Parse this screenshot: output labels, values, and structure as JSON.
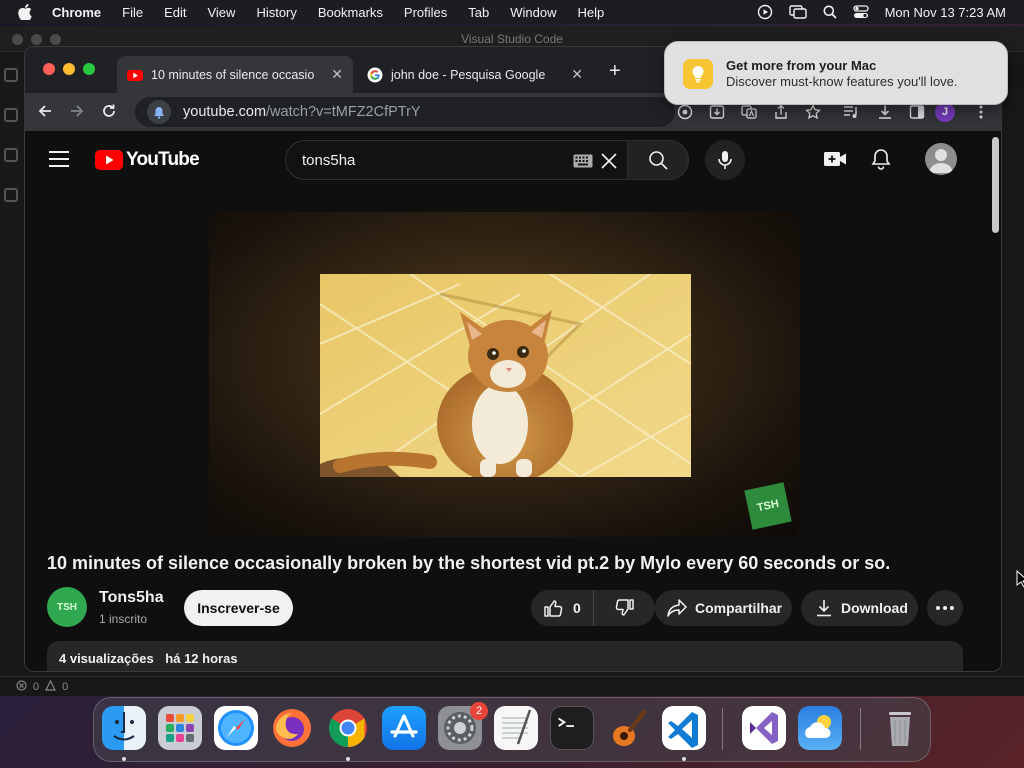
{
  "menubar": {
    "items": [
      "Chrome",
      "File",
      "Edit",
      "View",
      "History",
      "Bookmarks",
      "Profiles",
      "Tab",
      "Window",
      "Help"
    ],
    "datetime": "Mon Nov 13  7:23 AM"
  },
  "vscode": {
    "title": "Visual Studio Code",
    "status_problems": "0",
    "status_warnings": "0"
  },
  "chrome": {
    "tabs": [
      {
        "title": "10 minutes of silence occasio",
        "favicon": "youtube-favicon",
        "active": true
      },
      {
        "title": "john doe - Pesquisa Google",
        "favicon": "google-favicon",
        "active": false
      }
    ],
    "url_host": "youtube.com",
    "url_path": "/watch?v=tMFZ2CfPTrY",
    "profile_initial": "J"
  },
  "notification": {
    "title": "Get more from your Mac",
    "body": "Discover must-know features you'll love."
  },
  "youtube": {
    "logo_text": "YouTube",
    "search_value": "tons5ha",
    "video_title": "10 minutes of silence occasionally broken by the shortest vid pt.2 by Mylo every 60 seconds or so.",
    "channel_name": "Tons5ha",
    "subscribers": "1 inscrito",
    "subscribe_label": "Inscrever-se",
    "like_count": "0",
    "share_label": "Compartilhar",
    "download_label": "Download",
    "views": "4 visualizações",
    "uploaded": "há 12 horas"
  },
  "dock": {
    "apps": [
      "finder-icon",
      "launchpad-icon",
      "safari-icon",
      "firefox-icon",
      "chrome-icon",
      "app-store-icon",
      "system-settings-icon",
      "textedit-icon",
      "terminal-icon",
      "garageband-icon",
      "vscode-icon",
      "visual-studio-icon",
      "weather-icon",
      "trash-icon"
    ],
    "settings_badge": "2"
  },
  "colors": {
    "youtube_red": "#ff0000",
    "page_bg": "#0f0f0f",
    "pill_bg": "#272727",
    "tab_active": "#35363a",
    "notification_icon": "#f7c531"
  }
}
